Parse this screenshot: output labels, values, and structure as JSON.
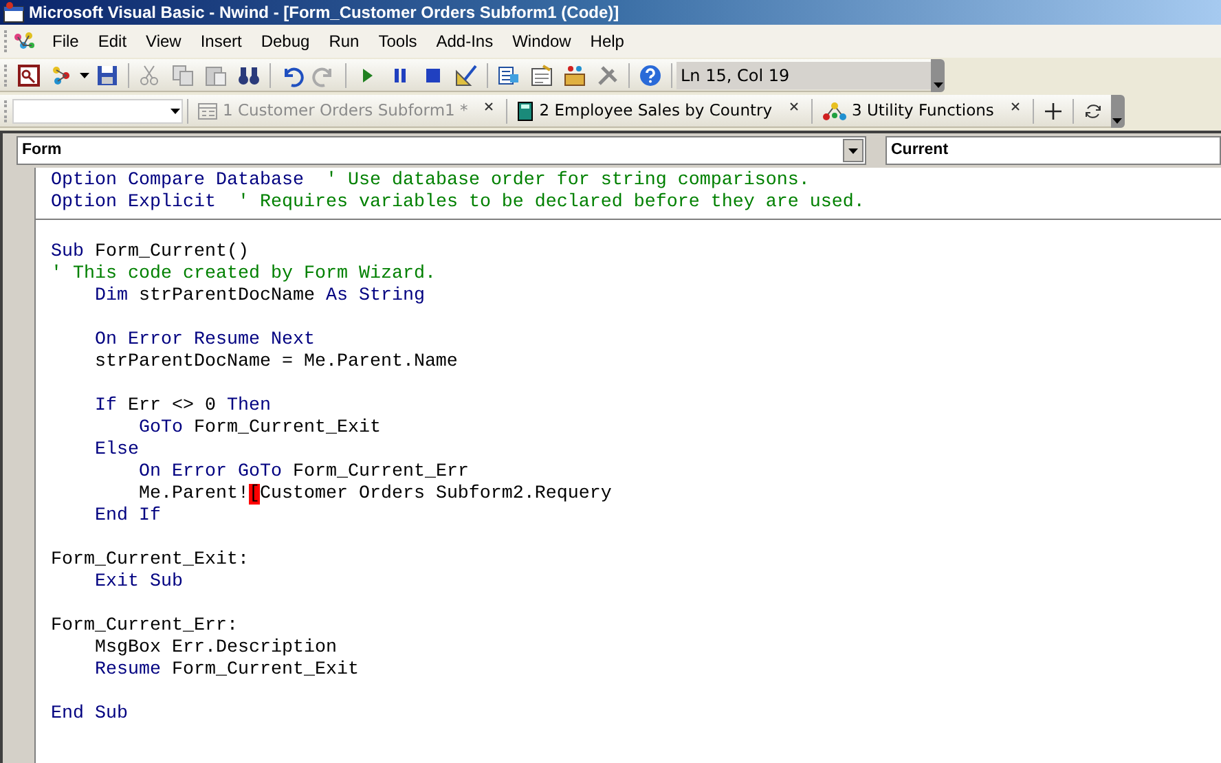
{
  "window": {
    "title": "Microsoft Visual Basic - Nwind - [Form_Customer Orders Subform1 (Code)]"
  },
  "menu": [
    "File",
    "Edit",
    "View",
    "Insert",
    "Debug",
    "Run",
    "Tools",
    "Add-Ins",
    "Window",
    "Help"
  ],
  "toolbar": {
    "position": "Ln 15, Col 19"
  },
  "tabs": [
    {
      "label": "1 Customer Orders Subform1 *",
      "selected": false,
      "kind": "form"
    },
    {
      "label": "2 Employee Sales by Country",
      "selected": true,
      "kind": "book"
    },
    {
      "label": "3 Utility Functions",
      "selected": true,
      "kind": "module"
    }
  ],
  "object_box": {
    "value": "Form"
  },
  "procedure_box": {
    "value": "Current"
  },
  "code": [
    {
      "lines": [
        {
          "kind": "code",
          "segments": [
            {
              "kind": "keyword",
              "text": "Option Compare Database"
            },
            {
              "kind": "comment",
              "text": "  ' Use database order for string comparisons."
            }
          ]
        },
        {
          "kind": "code",
          "segments": [
            {
              "kind": "keyword",
              "text": "Option Explicit"
            },
            {
              "kind": "comment",
              "text": "  ' Requires variables to be declared before they are used."
            }
          ]
        }
      ]
    },
    {
      "lines": [
        {
          "kind": "blank"
        },
        {
          "kind": "code",
          "segments": [
            {
              "kind": "keyword",
              "text": "Sub"
            },
            {
              "kind": "plain",
              "text": " Form_Current()"
            }
          ]
        },
        {
          "kind": "code",
          "segments": [
            {
              "kind": "comment",
              "text": "' This code created by Form Wizard."
            }
          ]
        },
        {
          "kind": "code",
          "segments": [
            {
              "kind": "keyword",
              "text": "    Dim"
            },
            {
              "kind": "plain",
              "text": " strParentDocName "
            },
            {
              "kind": "keyword",
              "text": "As String"
            }
          ]
        },
        {
          "kind": "blank"
        },
        {
          "kind": "code",
          "segments": [
            {
              "kind": "keyword",
              "text": "    On Error Resume Next"
            }
          ]
        },
        {
          "kind": "code",
          "segments": [
            {
              "kind": "plain",
              "text": "    strParentDocName = Me.Parent.Name"
            }
          ]
        },
        {
          "kind": "blank"
        },
        {
          "kind": "code",
          "segments": [
            {
              "kind": "keyword",
              "text": "    If"
            },
            {
              "kind": "plain",
              "text": " Err <> 0 "
            },
            {
              "kind": "keyword",
              "text": "Then"
            }
          ]
        },
        {
          "kind": "code",
          "segments": [
            {
              "kind": "keyword",
              "text": "        GoTo"
            },
            {
              "kind": "plain",
              "text": " Form_Current_Exit"
            }
          ]
        },
        {
          "kind": "code",
          "segments": [
            {
              "kind": "keyword",
              "text": "    Else"
            }
          ]
        },
        {
          "kind": "code",
          "segments": [
            {
              "kind": "keyword",
              "text": "        On Error GoTo"
            },
            {
              "kind": "plain",
              "text": " Form_Current_Err"
            }
          ]
        },
        {
          "kind": "code",
          "segments": [
            {
              "kind": "plain",
              "text": "        Me.Parent!"
            },
            {
              "kind": "error",
              "text": "["
            },
            {
              "kind": "plain",
              "text": "Customer Orders Subform2.Requery"
            }
          ]
        },
        {
          "kind": "code",
          "segments": [
            {
              "kind": "keyword",
              "text": "    End If"
            }
          ]
        },
        {
          "kind": "blank"
        },
        {
          "kind": "code",
          "segments": [
            {
              "kind": "plain",
              "text": "Form_Current_Exit:"
            }
          ]
        },
        {
          "kind": "code",
          "segments": [
            {
              "kind": "keyword",
              "text": "    Exit Sub"
            }
          ]
        },
        {
          "kind": "blank"
        },
        {
          "kind": "code",
          "segments": [
            {
              "kind": "plain",
              "text": "Form_Current_Err:"
            }
          ]
        },
        {
          "kind": "code",
          "segments": [
            {
              "kind": "plain",
              "text": "    MsgBox Err.Description"
            }
          ]
        },
        {
          "kind": "code",
          "segments": [
            {
              "kind": "keyword",
              "text": "    Resume"
            },
            {
              "kind": "plain",
              "text": " Form_Current_Exit"
            }
          ]
        },
        {
          "kind": "blank"
        },
        {
          "kind": "code",
          "segments": [
            {
              "kind": "keyword",
              "text": "End Sub"
            }
          ]
        }
      ]
    }
  ]
}
